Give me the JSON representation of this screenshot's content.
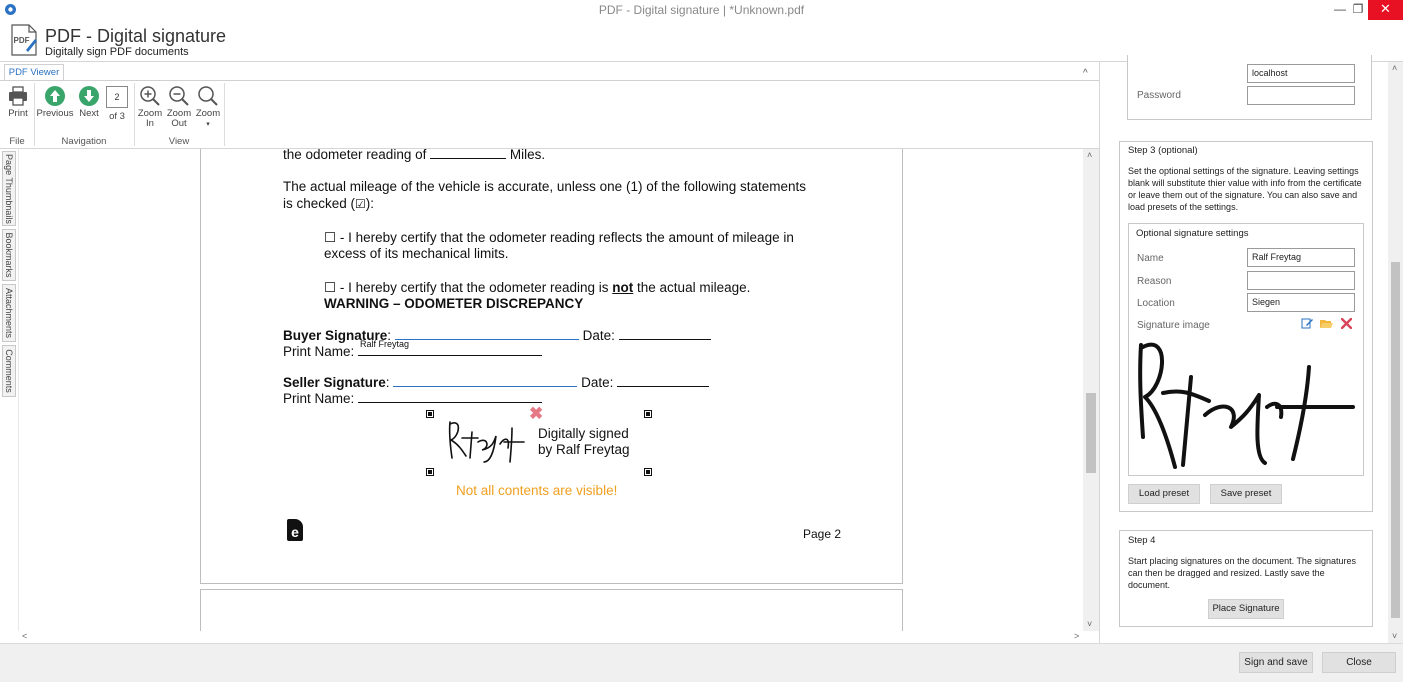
{
  "window": {
    "title": "PDF - Digital signature | *Unknown.pdf",
    "minimize_glyph": "—",
    "restore_glyph": "❐",
    "close_glyph": "✕"
  },
  "header": {
    "title": "PDF - Digital signature",
    "subtitle": "Digitally sign PDF documents",
    "icon_text": "PDF"
  },
  "ribbon": {
    "tab": "PDF Viewer",
    "collapse_glyph": "^",
    "print": "Print",
    "previous": "Previous",
    "next": "Next",
    "page_number": "2",
    "page_of": "of 3",
    "zoom_in_1": "Zoom",
    "zoom_in_2": "In",
    "zoom_out_1": "Zoom",
    "zoom_out_2": "Out",
    "zoom": "Zoom",
    "zoom_caret": "▾",
    "group_file": "File",
    "group_navigation": "Navigation",
    "group_view": "View"
  },
  "side_tabs": [
    "Page Thumbnails",
    "Bookmarks",
    "Attachments",
    "Comments"
  ],
  "document": {
    "line1a": "the odometer reading of",
    "line1b": "Miles.",
    "para1_l1": "The actual mileage of the vehicle is accurate, unless one (1) of the following statements",
    "para1_l2a": "is checked (",
    "para1_check": "☑",
    "para1_l2b": "):",
    "opt1_l1": "☐ - I hereby certify that the odometer reading reflects the amount of mileage in",
    "opt1_l2": "excess of its mechanical limits.",
    "opt2_a": "☐ - I hereby certify that the odometer reading is",
    "opt2_not": "not",
    "opt2_b": "the actual mileage.",
    "warning": "WARNING – ODOMETER DISCREPANCY",
    "buyer_label": "Buyer Signature",
    "colon": ":",
    "date_label": "Date:",
    "print_name": "Print Name:",
    "buyer_name": "Ralf Freytag",
    "seller_label": "Seller Signature",
    "sig_line1": "Digitally signed",
    "sig_line2": "by Ralf Freytag",
    "sig_warning": "Not all contents are visible!",
    "sig_delete": "✖",
    "page_label": "Page 2",
    "footer_logo": "e"
  },
  "scroll": {
    "up": "˄",
    "down": "˅",
    "left": "˂",
    "right": "˃"
  },
  "panel": {
    "host_value": "localhost",
    "password_label": "Password",
    "password_value": "",
    "step3_title": "Step 3 (optional)",
    "step3_text": "Set the optional settings of the signature. Leaving settings blank will substitute thier value with info from the certificate or leave them out of the signature. You can also save and load presets of the settings.",
    "optional_title": "Optional signature settings",
    "name_label": "Name",
    "name_value": "Ralf Freytag",
    "reason_label": "Reason",
    "reason_value": "",
    "location_label": "Location",
    "location_value": "Siegen",
    "sigimg_label": "Signature image",
    "load_preset": "Load preset",
    "save_preset": "Save preset",
    "step4_title": "Step 4",
    "step4_text": "Start placing signatures on the document. The signatures can then be dragged and resized. Lastly save the document.",
    "place_signature": "Place Signature"
  },
  "footer": {
    "sign_save": "Sign and save",
    "close": "Close"
  },
  "colors": {
    "accent": "#2b72c2",
    "nav_green": "#3aa56a",
    "warning_orange": "#f0a020",
    "delete_red": "#e57a86"
  }
}
